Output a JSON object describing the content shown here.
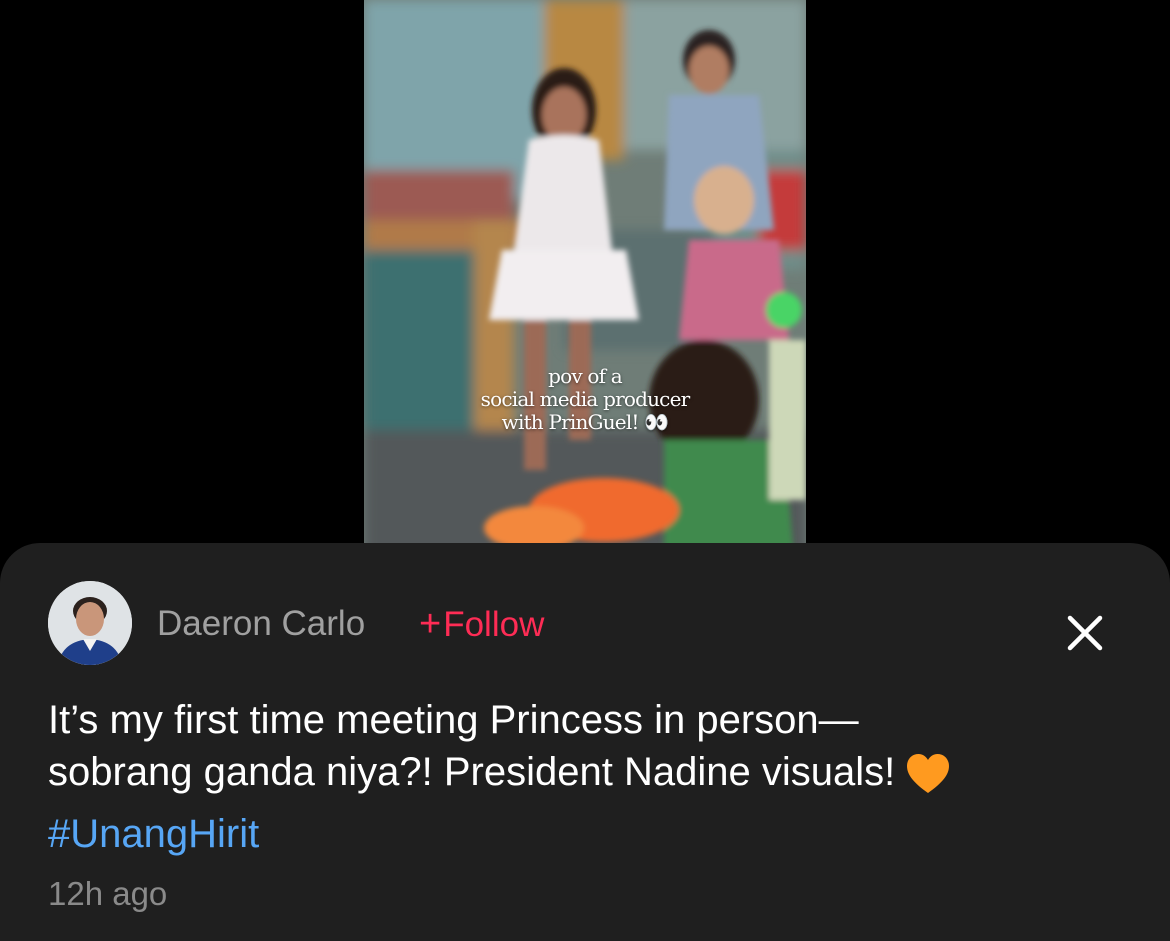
{
  "video": {
    "caption_lines": [
      "pov of a",
      "social media producer",
      "with PrinGuel! 👀"
    ]
  },
  "post": {
    "author_name": "Daeron Carlo",
    "follow_label": "Follow",
    "text_line_1": "It’s my first time meeting Princess in person—",
    "text_line_2": "sobrang ganda niya?! President Nadine visuals!",
    "hashtag": "#UnangHirit",
    "timestamp": "12h ago"
  },
  "colors": {
    "sheet_background": "#1f1f1f",
    "follow_accent": "#fe2c55",
    "hashtag_link": "#57a6f5",
    "heart_emoji": "#ff9a1f"
  },
  "icons": {
    "follow": "plus-icon",
    "close": "close-icon",
    "emoji": "orange-heart-icon"
  }
}
